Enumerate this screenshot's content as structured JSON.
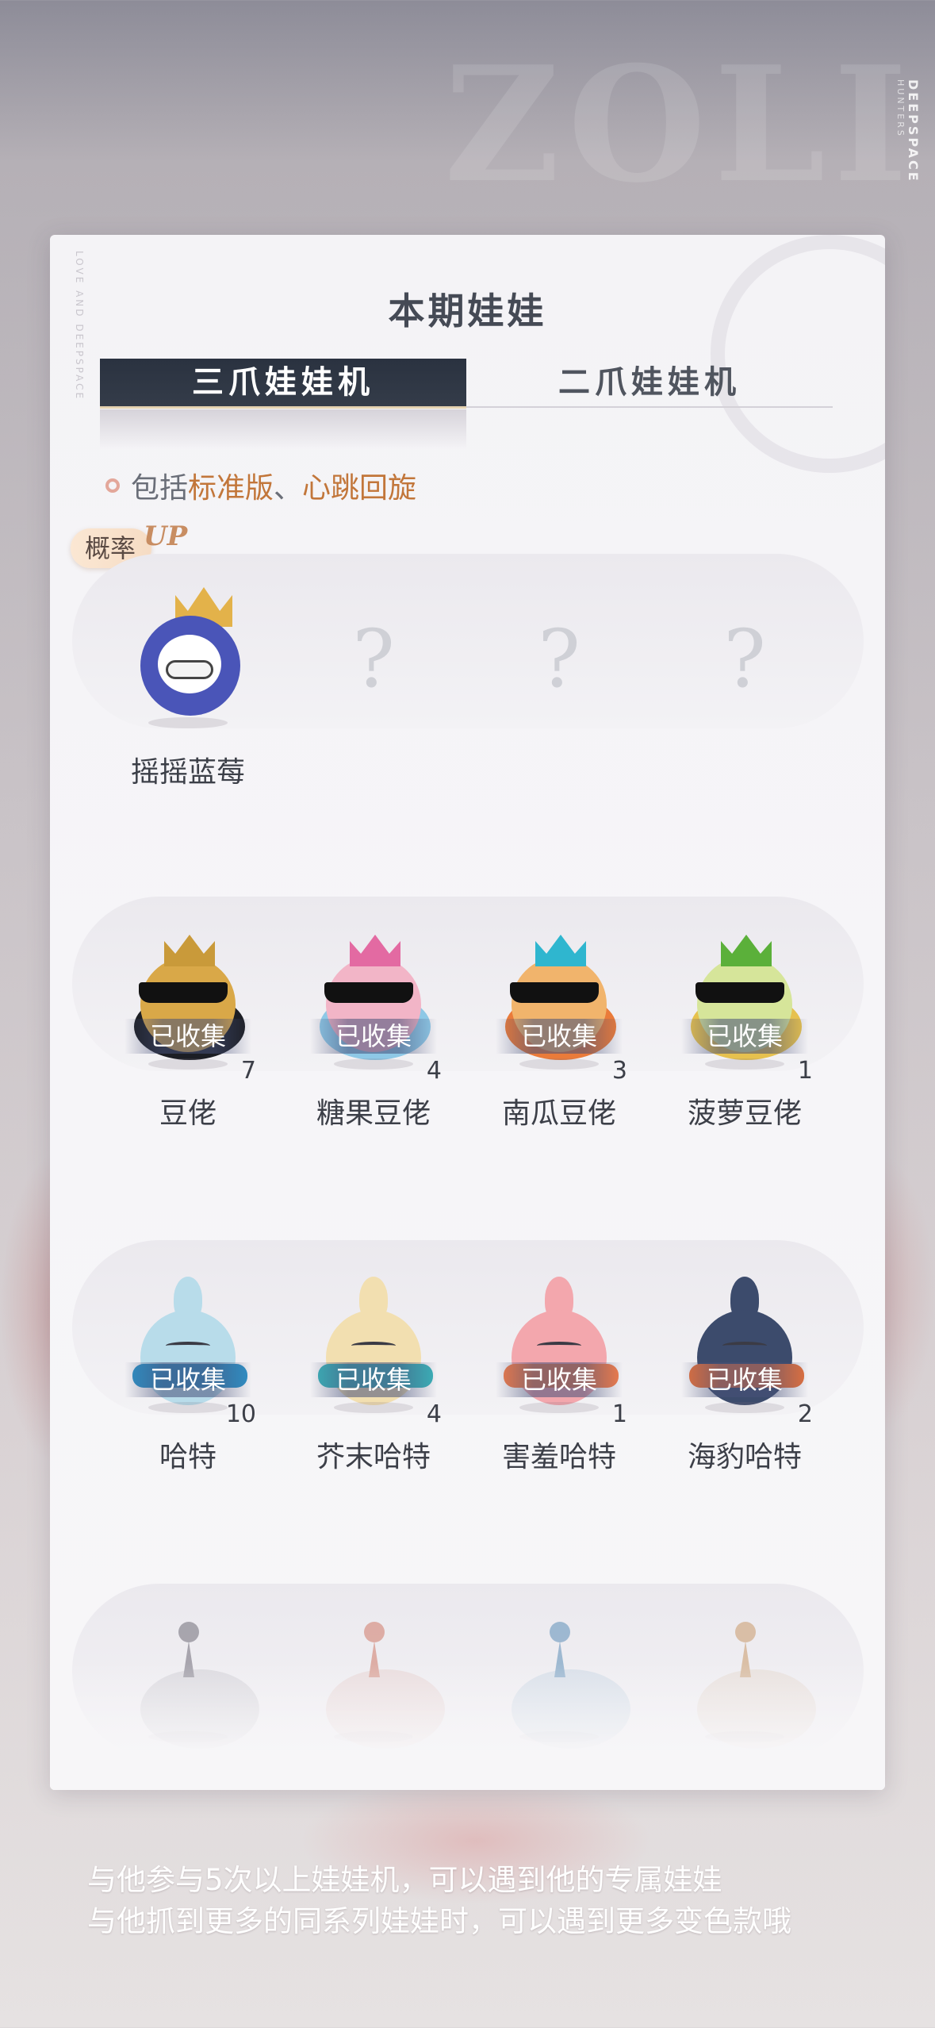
{
  "background": {
    "brand_text": "DEEPSPACE",
    "brand_sub": "HUNTERS"
  },
  "card": {
    "side_text": "LOVE AND DEEPSPACE",
    "title": "本期娃娃",
    "tabs": [
      {
        "label": "三爪娃娃机",
        "active": true
      },
      {
        "label": "二爪娃娃机",
        "active": false
      }
    ],
    "include": {
      "prefix": "包括",
      "item1": "标准版",
      "sep": "、",
      "item2": "心跳回旋"
    },
    "prob_badge": {
      "label": "概率",
      "up": "UP"
    },
    "row1": {
      "featured": {
        "name": "摇摇蓝莓",
        "icon": "blueberry-doll-icon"
      },
      "unknown": [
        "?",
        "?",
        "?"
      ]
    },
    "row2": [
      {
        "name": "豆佬",
        "status": "已收集",
        "count": "7",
        "crown": "#c99a3a",
        "body": "#d9a848",
        "suit": "#1c1e24"
      },
      {
        "name": "糖果豆佬",
        "status": "已收集",
        "count": "4",
        "crown": "#e36aa2",
        "body": "#f2b5c7",
        "suit": "#8ec8e6"
      },
      {
        "name": "南瓜豆佬",
        "status": "已收集",
        "count": "3",
        "crown": "#2fb6cf",
        "body": "#f1b46c",
        "suit": "#ea7b3a"
      },
      {
        "name": "菠萝豆佬",
        "status": "已收集",
        "count": "1",
        "crown": "#5bb03a",
        "body": "#d6e59a",
        "suit": "#e6c14e"
      }
    ],
    "row3": [
      {
        "name": "哈特",
        "status": "已收集",
        "count": "10",
        "body": "#b8dcea",
        "scarf": "#2f8fc4"
      },
      {
        "name": "芥末哈特",
        "status": "已收集",
        "count": "4",
        "body": "#f2dfb0",
        "scarf": "#3bb0b8"
      },
      {
        "name": "害羞哈特",
        "status": "已收集",
        "count": "1",
        "body": "#f3a7ad",
        "scarf": "#ee7c4c"
      },
      {
        "name": "海豹哈特",
        "status": "已收集",
        "count": "2",
        "body": "#3c4b6c",
        "scarf": "#e0703e"
      }
    ],
    "row4": [
      {
        "tip": "#6f6c78"
      },
      {
        "tip": "#d07a68"
      },
      {
        "tip": "#5d8fb8"
      },
      {
        "tip": "#c99a6a"
      }
    ]
  },
  "footer": {
    "line1": "与他参与5次以上娃娃机，可以遇到他的专属娃娃",
    "line2": "与他抓到更多的同系列娃娃时，可以遇到更多变色款哦"
  }
}
